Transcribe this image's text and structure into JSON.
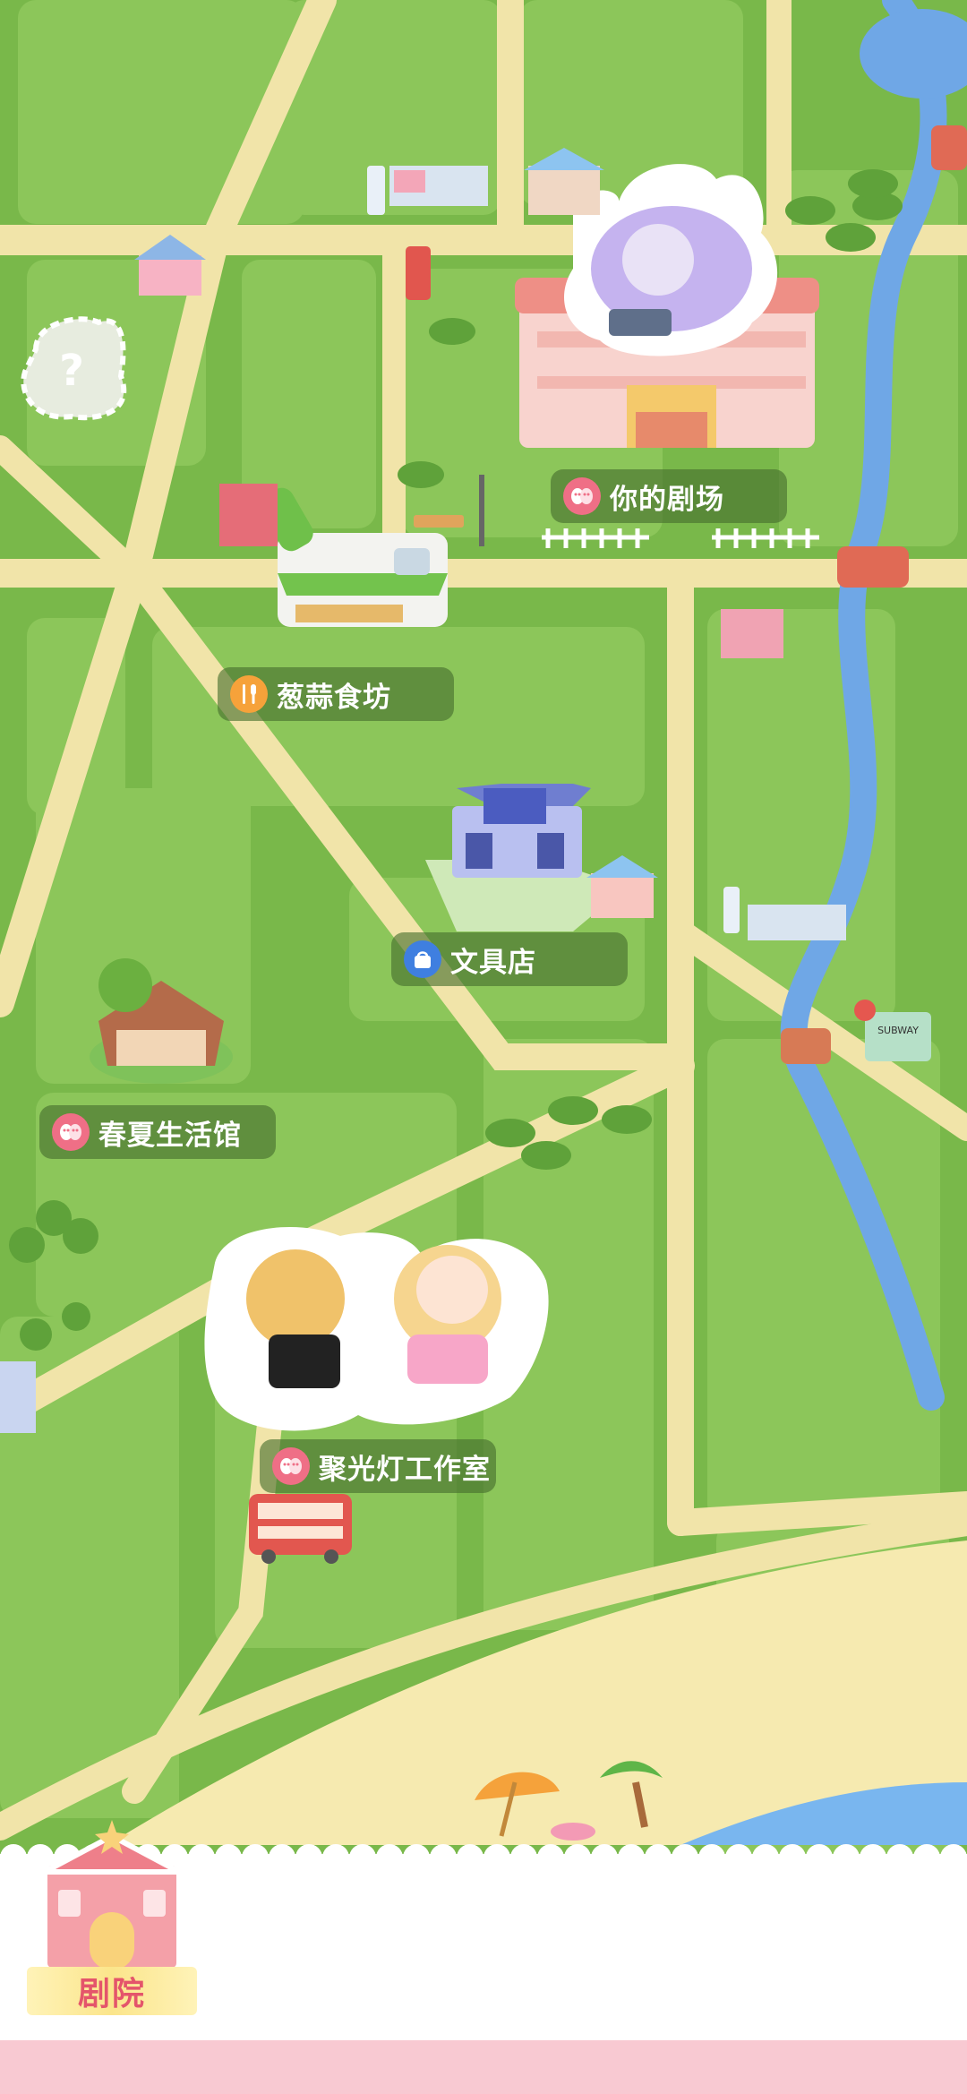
{
  "locations": {
    "your_theatre": {
      "label": "你的剧场"
    },
    "cong_suan_food_workshop": {
      "label": "葱蒜食坊"
    },
    "stationery_shop": {
      "label": "文具店"
    },
    "spring_summer_hall": {
      "label": "春夏生活馆"
    },
    "spotlight_studio": {
      "label": "聚光灯工作室"
    }
  },
  "bus_sign": {
    "text": "SUBWAY"
  },
  "bottom_nav": {
    "theatre_tab_label": "剧院"
  },
  "colors": {
    "grass": "#79b84a",
    "grass_light": "#8cc65a",
    "road": "#f1e4a9",
    "river": "#6fa7e6",
    "sand": "#f6eab0",
    "label_bg": "#466e2d",
    "theatre_icon": "#ef6f86",
    "food_icon": "#f6a23a",
    "shop_icon": "#3f7fe0",
    "bottom_pink": "#f8c9d2",
    "tab_text": "#e4556b"
  }
}
